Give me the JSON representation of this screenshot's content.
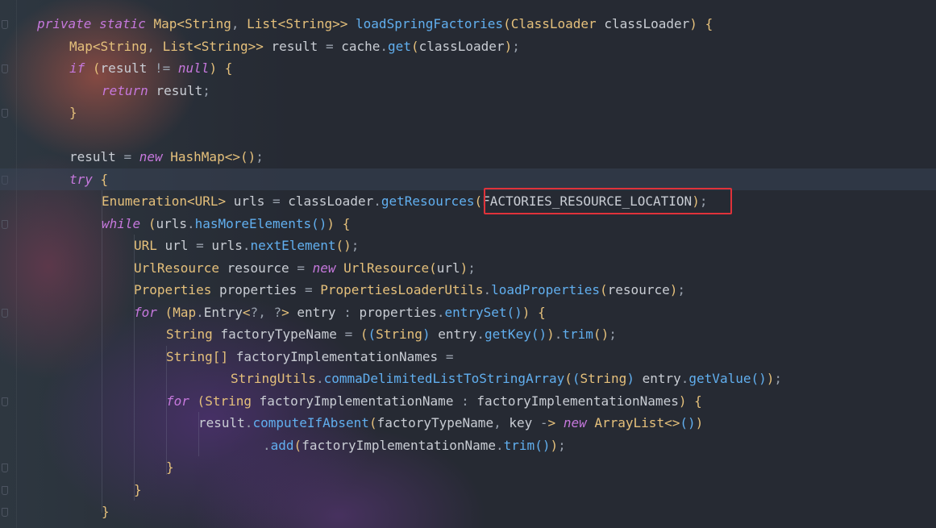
{
  "editor": {
    "language": "java",
    "highlighted_token": "(FACTORIES_RESOURCE_LOCATION);",
    "lines": [
      "private static Map<String, List<String>> loadSpringFactories(ClassLoader classLoader) {",
      "Map<String, List<String>> result = cache.get(classLoader);",
      "if (result != null) {",
      "return result;",
      "}",
      "",
      "result = new HashMap<>();",
      "try {",
      "Enumeration<URL> urls = classLoader.getResources(FACTORIES_RESOURCE_LOCATION);",
      "while (urls.hasMoreElements()) {",
      "URL url = urls.nextElement();",
      "UrlResource resource = new UrlResource(url);",
      "Properties properties = PropertiesLoaderUtils.loadProperties(resource);",
      "for (Map.Entry<?, ?> entry : properties.entrySet()) {",
      "String factoryTypeName = ((String) entry.getKey()).trim();",
      "String[] factoryImplementationNames =",
      "StringUtils.commaDelimitedListToStringArray((String) entry.getValue());",
      "for (String factoryImplementationName : factoryImplementationNames) {",
      "result.computeIfAbsent(factoryTypeName, key -> new ArrayList<>())",
      ".add(factoryImplementationName.trim());",
      "}",
      "}",
      "}"
    ]
  },
  "colors": {
    "keyword": "#c678dd",
    "type": "#e5c07b",
    "method": "#61afef",
    "plain": "#c9cdd4",
    "highlight_border": "#e0323a",
    "background": "#262a33"
  }
}
